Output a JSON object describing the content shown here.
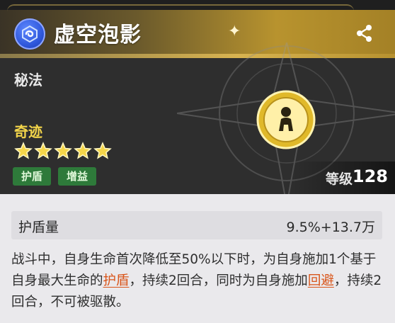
{
  "header": {
    "school_icon": "swirl-emblem-icon",
    "skill_name": "虚空泡影",
    "share_icon": "share-icon",
    "category": "秘法",
    "rarity": "奇迹",
    "stars": 5,
    "tags": [
      "护盾",
      "增益"
    ],
    "skill_icon": "person-orb-icon",
    "level_label": "等级",
    "level_value": "128"
  },
  "stat": {
    "label": "护盾量",
    "value": "9.5%+13.7万"
  },
  "description": {
    "p1": "战斗中，自身生命首次降低至50%以下时，为自身施加1个基于自身最大生命的",
    "kw1": "护盾",
    "p2": "，持续2回合，同时为自身施加",
    "kw2": "回避",
    "p3": "，持续2回合，不可被驱散。"
  },
  "colors": {
    "gold": "#d8b350",
    "tag_green": "#2e7a3a",
    "keyword_orange": "#d9551a",
    "rarity_yellow": "#f2d44a"
  }
}
